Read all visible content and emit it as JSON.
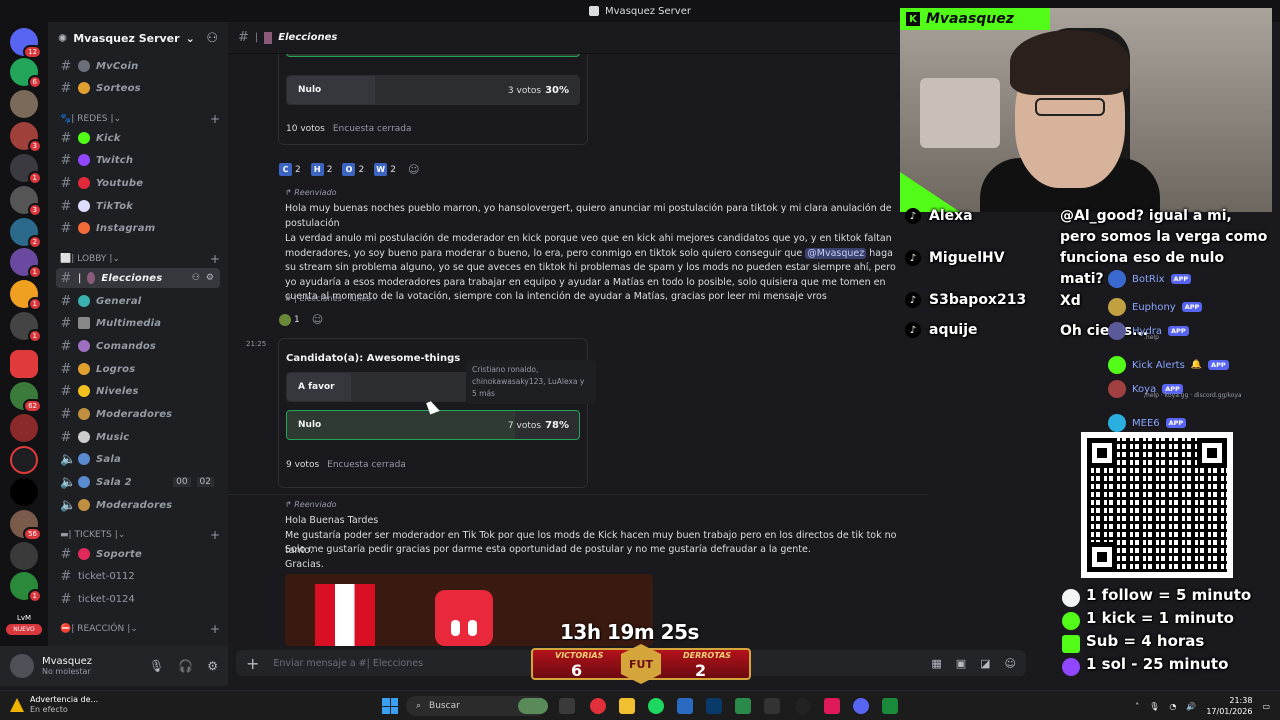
{
  "window": {
    "title": "Mvasquez Server"
  },
  "guild_badges": [
    "12",
    "6",
    "3",
    "1",
    "1",
    "3",
    "3",
    "2",
    "1",
    "1",
    "1",
    "62",
    "1",
    "56",
    "1"
  ],
  "guild_new": "NUEVO",
  "guild_lvm": "LvM",
  "server": {
    "name": "Mvasquez Server"
  },
  "channels": {
    "mvcoin": "MvCoin",
    "sorteos": "Sorteos",
    "cat_redes": "REDES",
    "kick": "Kick",
    "twitch": "Twitch",
    "youtube": "Youtube",
    "tiktok": "TikTok",
    "instagram": "Instagram",
    "cat_lobby": "LOBBY",
    "elecciones": "Elecciones",
    "general": "General",
    "multimedia": "Multimedia",
    "comandos": "Comandos",
    "logros": "Logros",
    "niveles": "Niveles",
    "moderadores": "Moderadores",
    "music": "Music",
    "sala": "Sala",
    "sala2": "Sala 2",
    "sala2_a": "00",
    "sala2_b": "02",
    "moderadores_voice": "Moderadores",
    "cat_tickets": "TICKETS",
    "soporte": "Soporte",
    "ticket1": "ticket-0112",
    "ticket2": "ticket-0124",
    "cat_reaccion": "REACCIÓN"
  },
  "user": {
    "name": "Mvasquez",
    "status": "No molestar"
  },
  "header": {
    "channel": "Elecciones"
  },
  "poll1": {
    "option": "Nulo",
    "votes": "3 votos",
    "percent": "30%",
    "percent_value": 30,
    "total": "10 votos",
    "status": "Encuesta cerrada"
  },
  "reactions": [
    {
      "letter": "C",
      "count": "2"
    },
    {
      "letter": "H",
      "count": "2"
    },
    {
      "letter": "O",
      "count": "2"
    },
    {
      "letter": "W",
      "count": "2"
    }
  ],
  "msg1": {
    "forwarded": "Reenviado",
    "line1": "Hola muy buenas noches pueblo marron, yo hansolovergert, quiero anunciar mi postulación para tiktok y mi clara anulación de postulación",
    "p2a": "La verdad anulo mi postulación de moderador en kick porque veo que en kick ahi mejores candidatos que yo, y en tiktok faltan moderadores, yo soy bueno para moderar o bueno, lo era, pero conmigo en tiktok solo quiero conseguir que",
    "mention": "@Mvasquez",
    "p2b": "haga su stream sin problema alguno, yo se que aveces en tiktok hi problemas de spam y los mods no pueden estar siempre ahí, pero yo ayudaría a esos moderadores para trabajar en equipo y ayudar a Matías en todo lo posible, solo quisiera que me tomen en cuenta al momento de la votación, siempre con la intención de ayudar a Matías, gracias por leer mi mensaje vros",
    "source": "# | Elecciones · lunes ›",
    "reaction_count": "1"
  },
  "poll2": {
    "time": "21:25",
    "title": "Candidato(a): Awesome-things",
    "option_a": "A favor",
    "option_b": "Nulo",
    "votes_b": "7 votos",
    "percent_b": "78%",
    "percent_b_value": 78,
    "total": "9 votos",
    "status": "Encuesta cerrada",
    "tooltip": "Cristiano ronaldo, chinokawasaky123, LuAlexa y 5 más"
  },
  "msg2": {
    "forwarded": "Reenviado",
    "l1": "Hola Buenas Tardes",
    "l2": " Me gustaría poder ser moderador en Tik Tok por que los mods de Kick hacen muy buen trabajo pero en los directos de tik tok no tanto.",
    "l3": "Solo me gustaría pedir gracias por darme esta oportunidad de postular y no me gustaría defraudar a la gente.",
    "l4": "Gracias."
  },
  "composer": {
    "placeholder": "Enviar mensaje a #| Elecciones"
  },
  "stream": {
    "cam_label": "Mvaasquez",
    "tiktok_users": [
      "Alexa",
      "MiguelHV",
      "S3bapox213",
      "aquije"
    ],
    "chat_text": "@Al_good? igual a mi, pero somos la verga como funciona eso de nulo mati?",
    "chat_xd": "Xd",
    "chat_oh": "Oh cielos...",
    "timer": "13h 19m 25s",
    "wins_label": "VICTORIAS",
    "wins": "6",
    "losses_label": "DERROTAS",
    "losses": "2",
    "badge": "FUT",
    "rules": [
      "1 follow = 5 minuto",
      "1 kick = 1 minuto",
      "Sub = 4 horas",
      "1 sol - 25 minuto"
    ]
  },
  "members": [
    {
      "name": "BotRix",
      "app": "APP"
    },
    {
      "name": "Euphony",
      "app": "APP"
    },
    {
      "name": "Hydra",
      "app": "APP",
      "sub": ".help"
    },
    {
      "name": "Kick Alerts",
      "app": "APP"
    },
    {
      "name": "Koya",
      "app": "APP",
      "sub": "/help · koya.gg · discord.gg/koya"
    },
    {
      "name": "MEE6",
      "app": "APP"
    }
  ],
  "taskbar": {
    "weather_title": "Advertencia de...",
    "weather_sub": "En efecto",
    "search": "Buscar",
    "time": "21:38",
    "date": "17/01/2026"
  },
  "colors": {
    "accent": "#5865f2",
    "kick_green": "#53fc18",
    "poll_win": "#23a55a"
  }
}
